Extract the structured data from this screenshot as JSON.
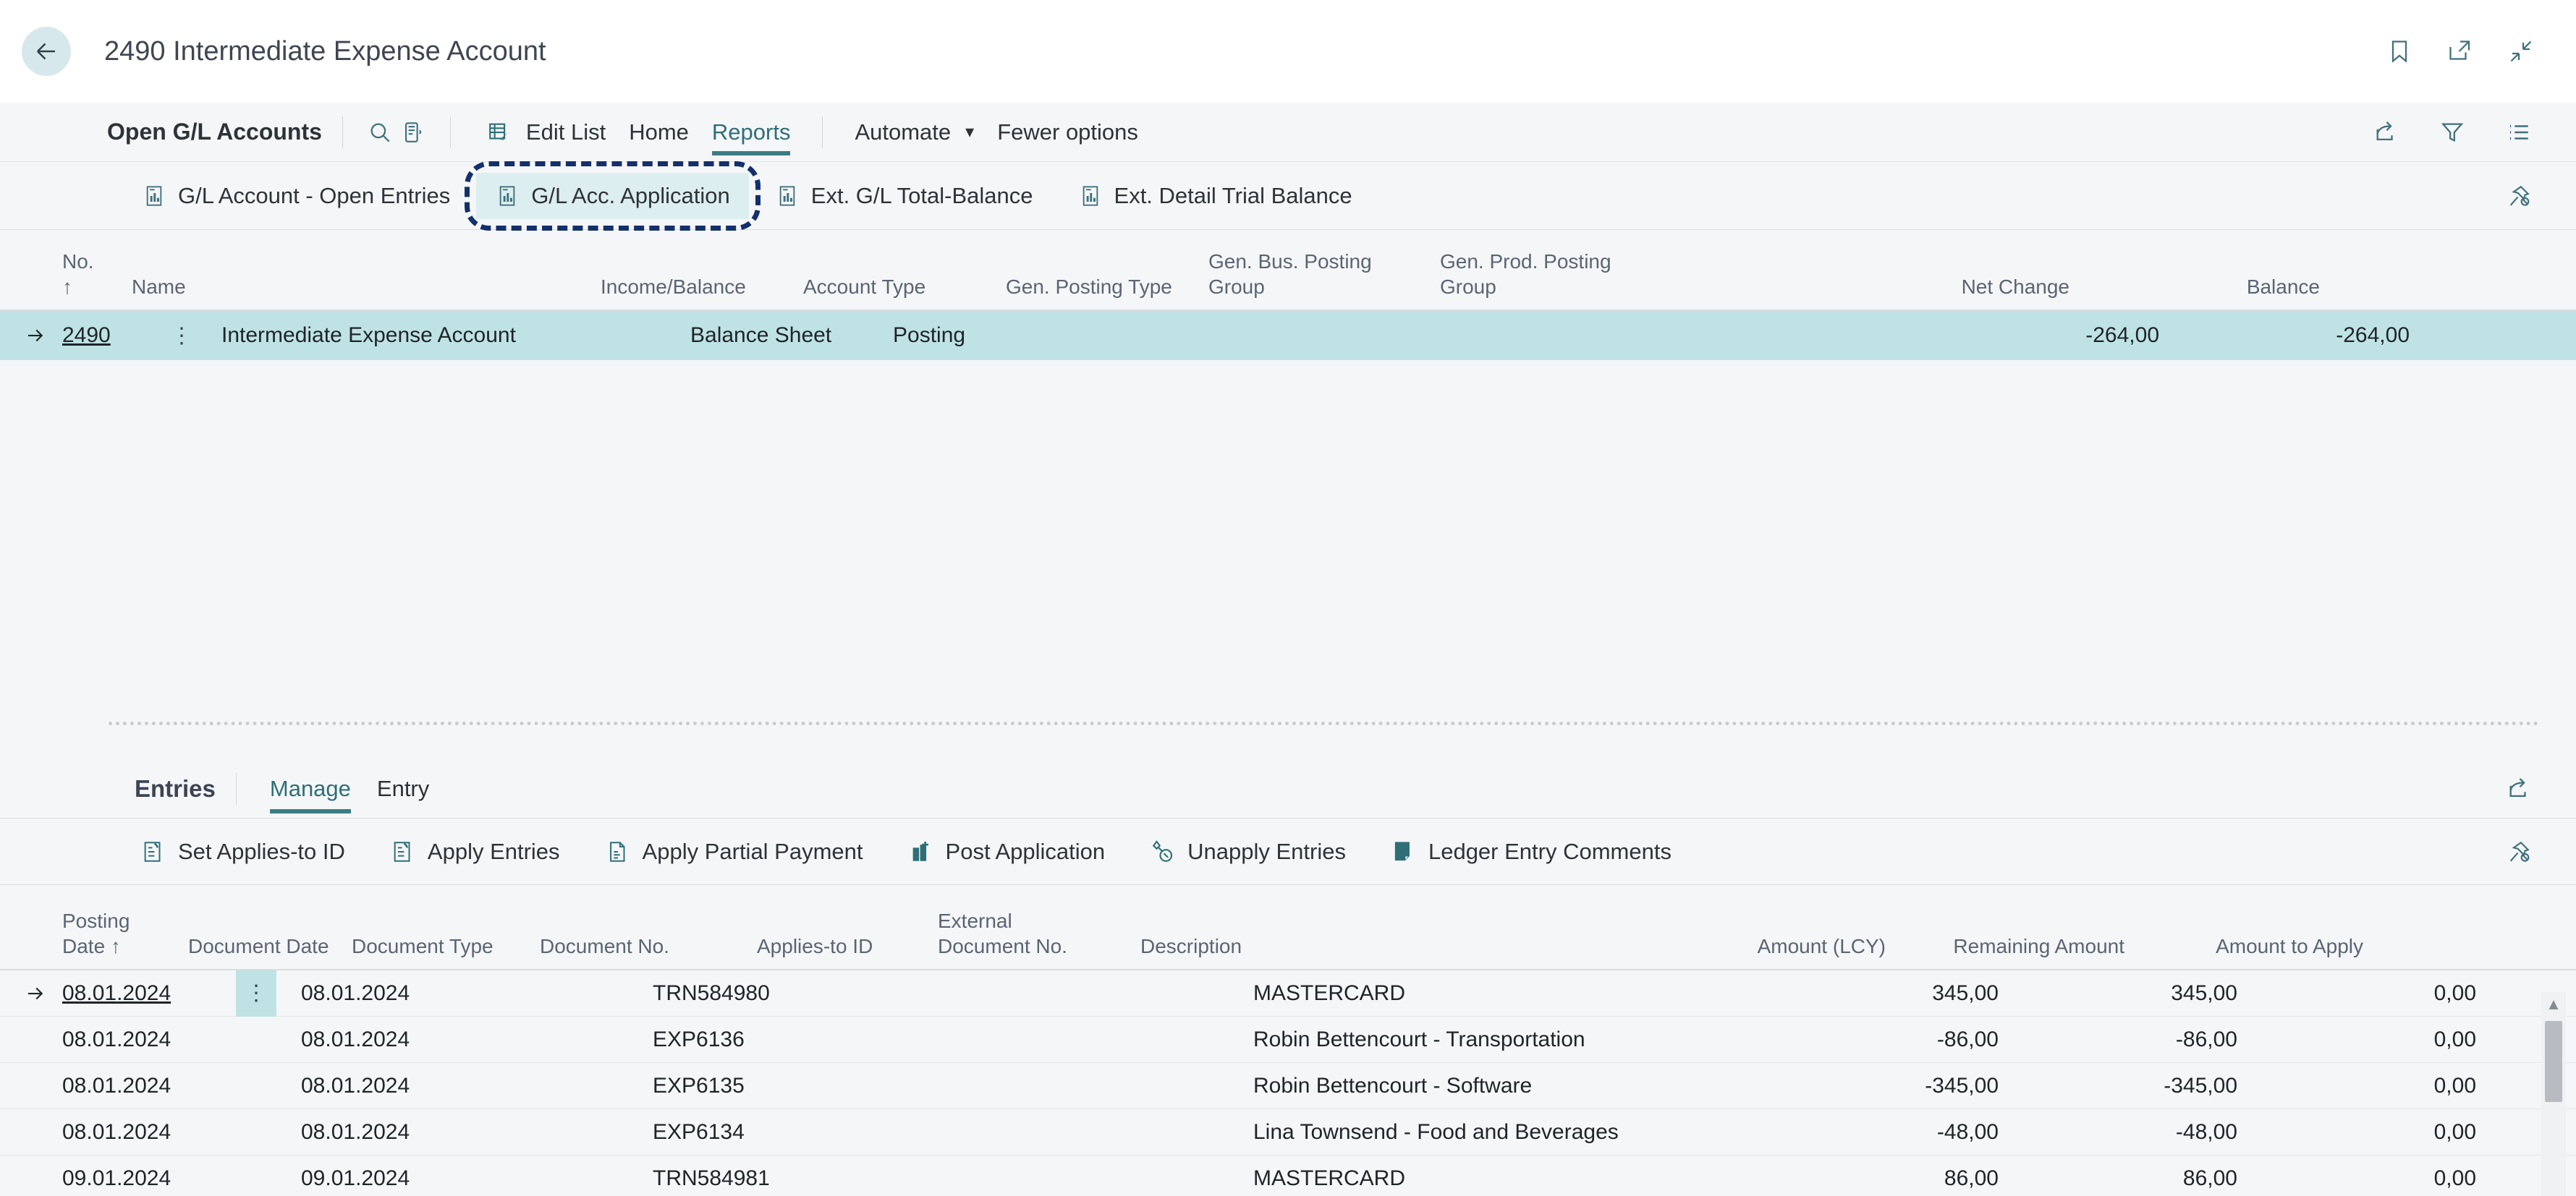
{
  "titlebar": {
    "title": "2490 Intermediate Expense Account",
    "icons": [
      "bookmark-icon",
      "open-in-new-window-icon",
      "collapse-icon"
    ]
  },
  "ribbon": {
    "page_name": "Open G/L Accounts",
    "search_icon": "search-icon",
    "focus_mode_icon": "focus-mode-icon",
    "items": [
      {
        "label": "Edit List",
        "icon": "edit-list-icon",
        "active": false
      },
      {
        "label": "Home",
        "icon": "",
        "active": false
      },
      {
        "label": "Reports",
        "icon": "",
        "active": true
      },
      {
        "label": "Automate",
        "icon": "chevron-down-icon",
        "active": false
      },
      {
        "label": "Fewer options",
        "icon": "",
        "active": false
      }
    ],
    "right_icons": [
      "share-icon",
      "filter-icon",
      "list-icon"
    ],
    "reports": [
      {
        "label": "G/L Account - Open Entries",
        "selected": false
      },
      {
        "label": "G/L Acc. Application",
        "selected": true
      },
      {
        "label": "Ext. G/L Total-Balance",
        "selected": false
      },
      {
        "label": "Ext. Detail Trial Balance",
        "selected": false
      }
    ],
    "pin_icon": "unpin-icon"
  },
  "accounts_grid": {
    "columns": [
      "No. ↑",
      "Name",
      "Income/Balance",
      "Account Type",
      "Gen. Posting Type",
      "Gen. Bus. Posting Group",
      "Gen. Prod. Posting Group",
      "Net Change",
      "Balance"
    ],
    "columns_split": {
      "gen_bus_line1": "Gen. Bus. Posting",
      "gen_bus_line2": "Group",
      "gen_prod_line1": "Gen. Prod. Posting",
      "gen_prod_line2": "Group"
    },
    "rows": [
      {
        "no": "2490",
        "name": "Intermediate Expense Account",
        "income_balance": "Balance Sheet",
        "account_type": "Posting",
        "gen_posting_type": "",
        "gen_bus_posting_group": "",
        "gen_prod_posting_group": "",
        "net_change": "-264,00",
        "balance": "-264,00",
        "selected": true
      }
    ]
  },
  "entries": {
    "title": "Entries",
    "tabs": [
      {
        "label": "Manage",
        "active": true
      },
      {
        "label": "Entry",
        "active": false
      }
    ],
    "share_icon": "share-icon",
    "pin_icon": "unpin-icon",
    "actions": [
      {
        "label": "Set Applies-to ID",
        "icon": "set-applies-to-id-icon"
      },
      {
        "label": "Apply Entries",
        "icon": "apply-entries-icon"
      },
      {
        "label": "Apply Partial Payment",
        "icon": "apply-partial-payment-icon"
      },
      {
        "label": "Post Application",
        "icon": "post-application-icon"
      },
      {
        "label": "Unapply Entries",
        "icon": "unapply-entries-icon"
      },
      {
        "label": "Ledger Entry Comments",
        "icon": "ledger-entry-comments-icon"
      }
    ]
  },
  "entries_grid": {
    "columns": [
      "Posting Date ↑",
      "Document Date",
      "Document Type",
      "Document No.",
      "Applies-to ID",
      "External Document No.",
      "Description",
      "Amount (LCY)",
      "Remaining Amount",
      "Amount to Apply"
    ],
    "columns_split": {
      "external_line1": "External",
      "external_line2": "Document No."
    },
    "rows": [
      {
        "posting_date": "08.01.2024",
        "document_date": "08.01.2024",
        "document_type": "",
        "document_no": "TRN584980",
        "applies_to_id": "",
        "external_document_no": "",
        "description": "MASTERCARD",
        "amount_lcy": "345,00",
        "remaining_amount": "345,00",
        "amount_to_apply": "0,00",
        "selected": true
      },
      {
        "posting_date": "08.01.2024",
        "document_date": "08.01.2024",
        "document_type": "",
        "document_no": "EXP6136",
        "applies_to_id": "",
        "external_document_no": "",
        "description": "Robin Bettencourt - Transportation",
        "amount_lcy": "-86,00",
        "remaining_amount": "-86,00",
        "amount_to_apply": "0,00",
        "selected": false
      },
      {
        "posting_date": "08.01.2024",
        "document_date": "08.01.2024",
        "document_type": "",
        "document_no": "EXP6135",
        "applies_to_id": "",
        "external_document_no": "",
        "description": "Robin Bettencourt - Software",
        "amount_lcy": "-345,00",
        "remaining_amount": "-345,00",
        "amount_to_apply": "0,00",
        "selected": false
      },
      {
        "posting_date": "08.01.2024",
        "document_date": "08.01.2024",
        "document_type": "",
        "document_no": "EXP6134",
        "applies_to_id": "",
        "external_document_no": "",
        "description": "Lina Townsend - Food and Beverages",
        "amount_lcy": "-48,00",
        "remaining_amount": "-48,00",
        "amount_to_apply": "0,00",
        "selected": false
      },
      {
        "posting_date": "09.01.2024",
        "document_date": "09.01.2024",
        "document_type": "",
        "document_no": "TRN584981",
        "applies_to_id": "",
        "external_document_no": "",
        "description": "MASTERCARD",
        "amount_lcy": "86,00",
        "remaining_amount": "86,00",
        "amount_to_apply": "0,00",
        "selected": false
      }
    ]
  },
  "colors": {
    "accent_teal": "#2e6f77",
    "selection_row": "#bfe3e5",
    "selection_button": "#ddeef0",
    "focus_ring": "#14306b",
    "page_bg": "#f5f6f8"
  }
}
